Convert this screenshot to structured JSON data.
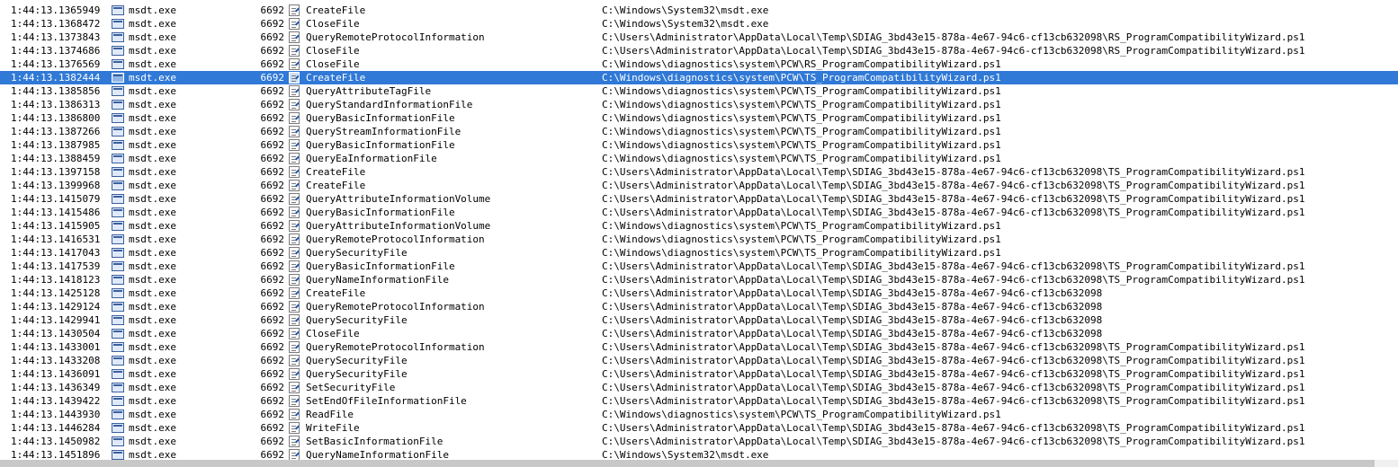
{
  "colors": {
    "selection_background": "#3079d6",
    "selection_text": "#ffffff"
  },
  "icons": {
    "process": "msdt-process-icon",
    "operation": "file-system-icon"
  },
  "selected_row": 5,
  "rows": [
    {
      "time": "1:44:13.1365949",
      "process": "msdt.exe",
      "pid": "6692",
      "operation": "CreateFile",
      "path": "C:\\Windows\\System32\\msdt.exe"
    },
    {
      "time": "1:44:13.1368472",
      "process": "msdt.exe",
      "pid": "6692",
      "operation": "CloseFile",
      "path": "C:\\Windows\\System32\\msdt.exe"
    },
    {
      "time": "1:44:13.1373843",
      "process": "msdt.exe",
      "pid": "6692",
      "operation": "QueryRemoteProtocolInformation",
      "path": "C:\\Users\\Administrator\\AppData\\Local\\Temp\\SDIAG_3bd43e15-878a-4e67-94c6-cf13cb632098\\RS_ProgramCompatibilityWizard.ps1"
    },
    {
      "time": "1:44:13.1374686",
      "process": "msdt.exe",
      "pid": "6692",
      "operation": "CloseFile",
      "path": "C:\\Users\\Administrator\\AppData\\Local\\Temp\\SDIAG_3bd43e15-878a-4e67-94c6-cf13cb632098\\RS_ProgramCompatibilityWizard.ps1"
    },
    {
      "time": "1:44:13.1376569",
      "process": "msdt.exe",
      "pid": "6692",
      "operation": "CloseFile",
      "path": "C:\\Windows\\diagnostics\\system\\PCW\\RS_ProgramCompatibilityWizard.ps1"
    },
    {
      "time": "1:44:13.1382444",
      "process": "msdt.exe",
      "pid": "6692",
      "operation": "CreateFile",
      "path": "C:\\Windows\\diagnostics\\system\\PCW\\TS_ProgramCompatibilityWizard.ps1"
    },
    {
      "time": "1:44:13.1385856",
      "process": "msdt.exe",
      "pid": "6692",
      "operation": "QueryAttributeTagFile",
      "path": "C:\\Windows\\diagnostics\\system\\PCW\\TS_ProgramCompatibilityWizard.ps1"
    },
    {
      "time": "1:44:13.1386313",
      "process": "msdt.exe",
      "pid": "6692",
      "operation": "QueryStandardInformationFile",
      "path": "C:\\Windows\\diagnostics\\system\\PCW\\TS_ProgramCompatibilityWizard.ps1"
    },
    {
      "time": "1:44:13.1386800",
      "process": "msdt.exe",
      "pid": "6692",
      "operation": "QueryBasicInformationFile",
      "path": "C:\\Windows\\diagnostics\\system\\PCW\\TS_ProgramCompatibilityWizard.ps1"
    },
    {
      "time": "1:44:13.1387266",
      "process": "msdt.exe",
      "pid": "6692",
      "operation": "QueryStreamInformationFile",
      "path": "C:\\Windows\\diagnostics\\system\\PCW\\TS_ProgramCompatibilityWizard.ps1"
    },
    {
      "time": "1:44:13.1387985",
      "process": "msdt.exe",
      "pid": "6692",
      "operation": "QueryBasicInformationFile",
      "path": "C:\\Windows\\diagnostics\\system\\PCW\\TS_ProgramCompatibilityWizard.ps1"
    },
    {
      "time": "1:44:13.1388459",
      "process": "msdt.exe",
      "pid": "6692",
      "operation": "QueryEaInformationFile",
      "path": "C:\\Windows\\diagnostics\\system\\PCW\\TS_ProgramCompatibilityWizard.ps1"
    },
    {
      "time": "1:44:13.1397158",
      "process": "msdt.exe",
      "pid": "6692",
      "operation": "CreateFile",
      "path": "C:\\Users\\Administrator\\AppData\\Local\\Temp\\SDIAG_3bd43e15-878a-4e67-94c6-cf13cb632098\\TS_ProgramCompatibilityWizard.ps1"
    },
    {
      "time": "1:44:13.1399968",
      "process": "msdt.exe",
      "pid": "6692",
      "operation": "CreateFile",
      "path": "C:\\Users\\Administrator\\AppData\\Local\\Temp\\SDIAG_3bd43e15-878a-4e67-94c6-cf13cb632098\\TS_ProgramCompatibilityWizard.ps1"
    },
    {
      "time": "1:44:13.1415079",
      "process": "msdt.exe",
      "pid": "6692",
      "operation": "QueryAttributeInformationVolume",
      "path": "C:\\Users\\Administrator\\AppData\\Local\\Temp\\SDIAG_3bd43e15-878a-4e67-94c6-cf13cb632098\\TS_ProgramCompatibilityWizard.ps1"
    },
    {
      "time": "1:44:13.1415486",
      "process": "msdt.exe",
      "pid": "6692",
      "operation": "QueryBasicInformationFile",
      "path": "C:\\Users\\Administrator\\AppData\\Local\\Temp\\SDIAG_3bd43e15-878a-4e67-94c6-cf13cb632098\\TS_ProgramCompatibilityWizard.ps1"
    },
    {
      "time": "1:44:13.1415905",
      "process": "msdt.exe",
      "pid": "6692",
      "operation": "QueryAttributeInformationVolume",
      "path": "C:\\Windows\\diagnostics\\system\\PCW\\TS_ProgramCompatibilityWizard.ps1"
    },
    {
      "time": "1:44:13.1416531",
      "process": "msdt.exe",
      "pid": "6692",
      "operation": "QueryRemoteProtocolInformation",
      "path": "C:\\Windows\\diagnostics\\system\\PCW\\TS_ProgramCompatibilityWizard.ps1"
    },
    {
      "time": "1:44:13.1417043",
      "process": "msdt.exe",
      "pid": "6692",
      "operation": "QuerySecurityFile",
      "path": "C:\\Windows\\diagnostics\\system\\PCW\\TS_ProgramCompatibilityWizard.ps1"
    },
    {
      "time": "1:44:13.1417539",
      "process": "msdt.exe",
      "pid": "6692",
      "operation": "QueryBasicInformationFile",
      "path": "C:\\Users\\Administrator\\AppData\\Local\\Temp\\SDIAG_3bd43e15-878a-4e67-94c6-cf13cb632098\\TS_ProgramCompatibilityWizard.ps1"
    },
    {
      "time": "1:44:13.1418123",
      "process": "msdt.exe",
      "pid": "6692",
      "operation": "QueryNameInformationFile",
      "path": "C:\\Users\\Administrator\\AppData\\Local\\Temp\\SDIAG_3bd43e15-878a-4e67-94c6-cf13cb632098\\TS_ProgramCompatibilityWizard.ps1"
    },
    {
      "time": "1:44:13.1425128",
      "process": "msdt.exe",
      "pid": "6692",
      "operation": "CreateFile",
      "path": "C:\\Users\\Administrator\\AppData\\Local\\Temp\\SDIAG_3bd43e15-878a-4e67-94c6-cf13cb632098"
    },
    {
      "time": "1:44:13.1429124",
      "process": "msdt.exe",
      "pid": "6692",
      "operation": "QueryRemoteProtocolInformation",
      "path": "C:\\Users\\Administrator\\AppData\\Local\\Temp\\SDIAG_3bd43e15-878a-4e67-94c6-cf13cb632098"
    },
    {
      "time": "1:44:13.1429941",
      "process": "msdt.exe",
      "pid": "6692",
      "operation": "QuerySecurityFile",
      "path": "C:\\Users\\Administrator\\AppData\\Local\\Temp\\SDIAG_3bd43e15-878a-4e67-94c6-cf13cb632098"
    },
    {
      "time": "1:44:13.1430504",
      "process": "msdt.exe",
      "pid": "6692",
      "operation": "CloseFile",
      "path": "C:\\Users\\Administrator\\AppData\\Local\\Temp\\SDIAG_3bd43e15-878a-4e67-94c6-cf13cb632098"
    },
    {
      "time": "1:44:13.1433001",
      "process": "msdt.exe",
      "pid": "6692",
      "operation": "QueryRemoteProtocolInformation",
      "path": "C:\\Users\\Administrator\\AppData\\Local\\Temp\\SDIAG_3bd43e15-878a-4e67-94c6-cf13cb632098\\TS_ProgramCompatibilityWizard.ps1"
    },
    {
      "time": "1:44:13.1433208",
      "process": "msdt.exe",
      "pid": "6692",
      "operation": "QuerySecurityFile",
      "path": "C:\\Users\\Administrator\\AppData\\Local\\Temp\\SDIAG_3bd43e15-878a-4e67-94c6-cf13cb632098\\TS_ProgramCompatibilityWizard.ps1"
    },
    {
      "time": "1:44:13.1436091",
      "process": "msdt.exe",
      "pid": "6692",
      "operation": "QuerySecurityFile",
      "path": "C:\\Users\\Administrator\\AppData\\Local\\Temp\\SDIAG_3bd43e15-878a-4e67-94c6-cf13cb632098\\TS_ProgramCompatibilityWizard.ps1"
    },
    {
      "time": "1:44:13.1436349",
      "process": "msdt.exe",
      "pid": "6692",
      "operation": "SetSecurityFile",
      "path": "C:\\Users\\Administrator\\AppData\\Local\\Temp\\SDIAG_3bd43e15-878a-4e67-94c6-cf13cb632098\\TS_ProgramCompatibilityWizard.ps1"
    },
    {
      "time": "1:44:13.1439422",
      "process": "msdt.exe",
      "pid": "6692",
      "operation": "SetEndOfFileInformationFile",
      "path": "C:\\Users\\Administrator\\AppData\\Local\\Temp\\SDIAG_3bd43e15-878a-4e67-94c6-cf13cb632098\\TS_ProgramCompatibilityWizard.ps1"
    },
    {
      "time": "1:44:13.1443930",
      "process": "msdt.exe",
      "pid": "6692",
      "operation": "ReadFile",
      "path": "C:\\Windows\\diagnostics\\system\\PCW\\TS_ProgramCompatibilityWizard.ps1"
    },
    {
      "time": "1:44:13.1446284",
      "process": "msdt.exe",
      "pid": "6692",
      "operation": "WriteFile",
      "path": "C:\\Users\\Administrator\\AppData\\Local\\Temp\\SDIAG_3bd43e15-878a-4e67-94c6-cf13cb632098\\TS_ProgramCompatibilityWizard.ps1"
    },
    {
      "time": "1:44:13.1450982",
      "process": "msdt.exe",
      "pid": "6692",
      "operation": "SetBasicInformationFile",
      "path": "C:\\Users\\Administrator\\AppData\\Local\\Temp\\SDIAG_3bd43e15-878a-4e67-94c6-cf13cb632098\\TS_ProgramCompatibilityWizard.ps1"
    },
    {
      "time": "1:44:13.1451896",
      "process": "msdt.exe",
      "pid": "6692",
      "operation": "QueryNameInformationFile",
      "path": "C:\\Windows\\System32\\msdt.exe"
    }
  ]
}
